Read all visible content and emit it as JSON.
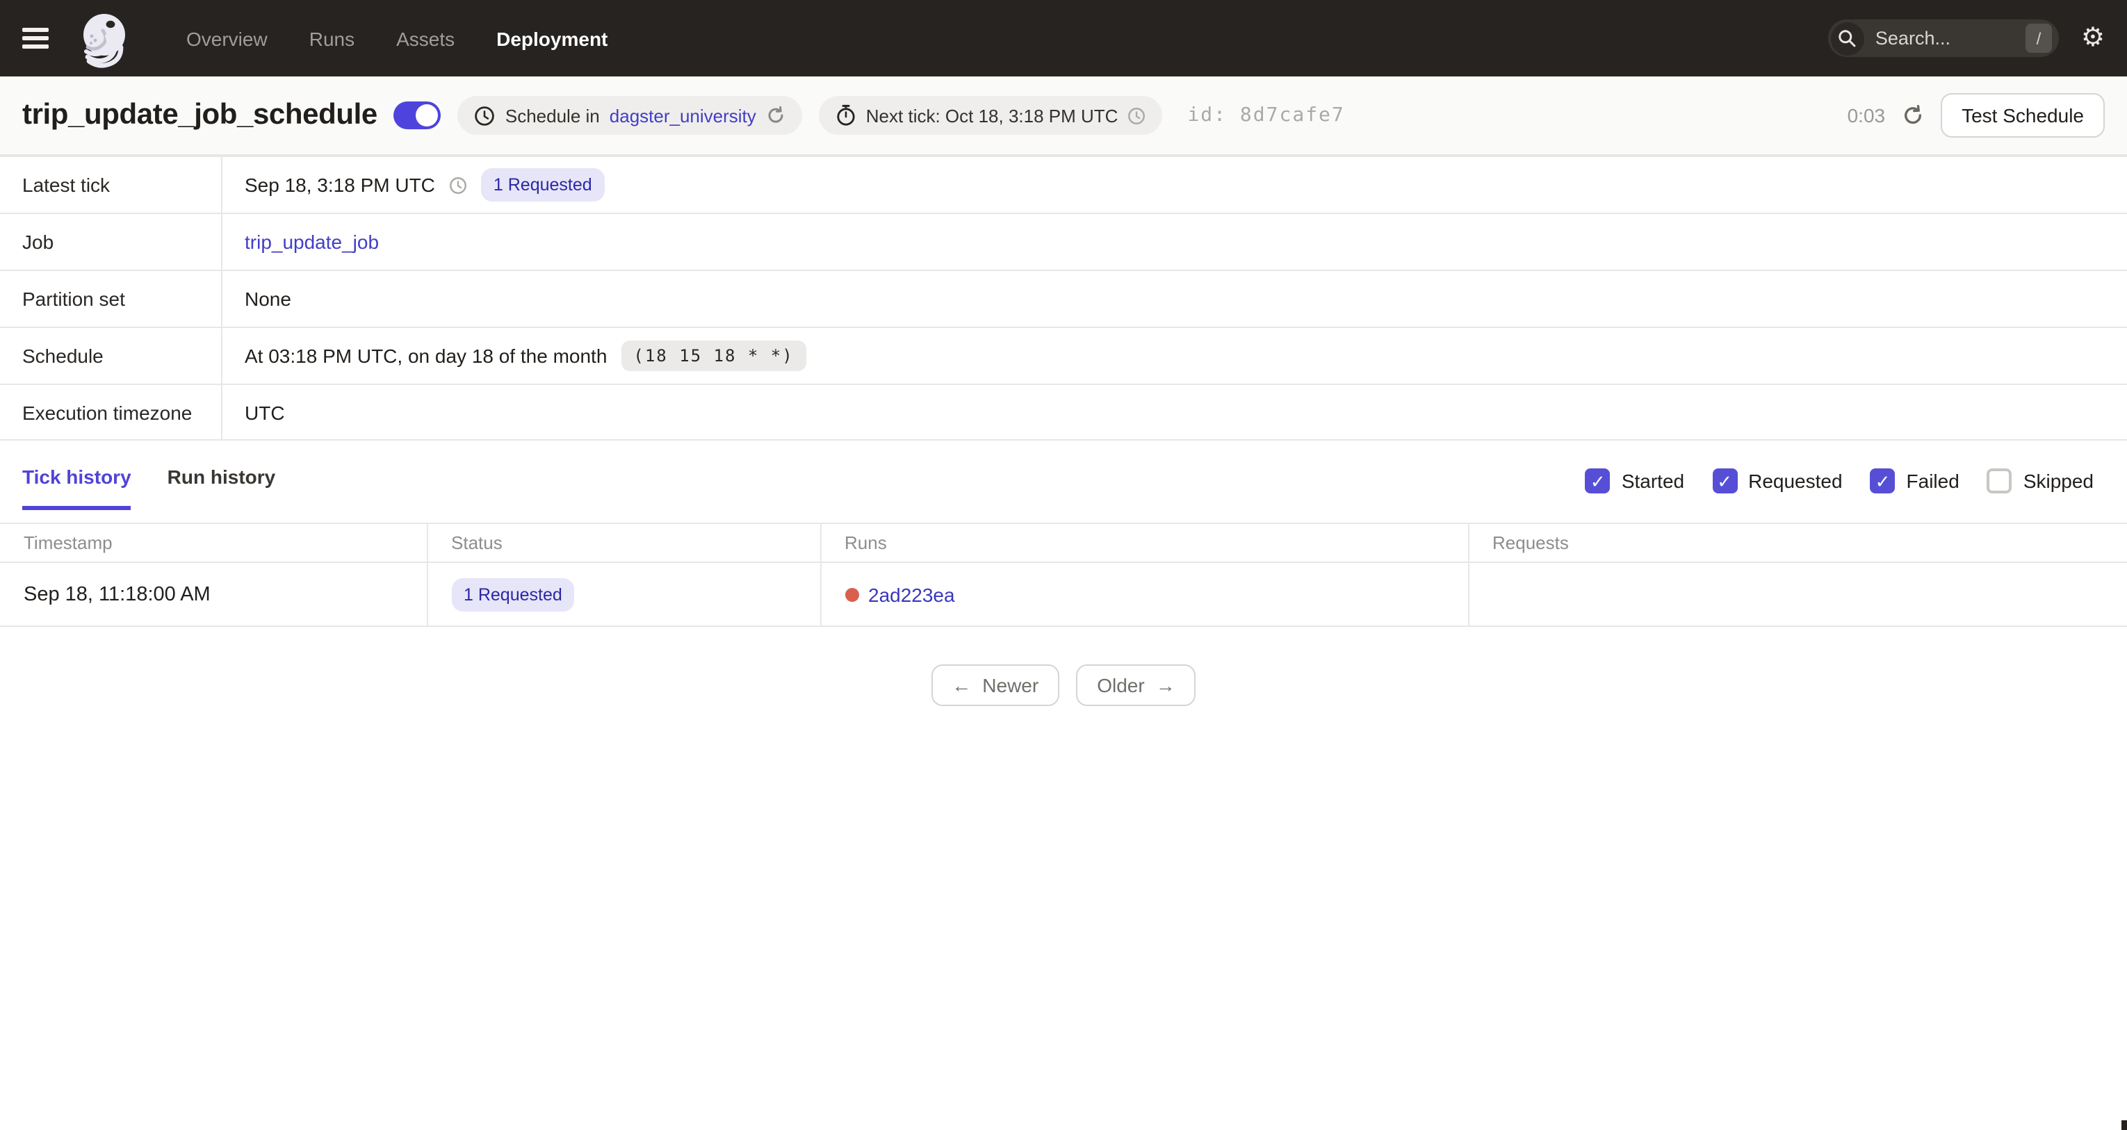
{
  "nav": {
    "links": [
      {
        "label": "Overview",
        "active": false
      },
      {
        "label": "Runs",
        "active": false
      },
      {
        "label": "Assets",
        "active": false
      },
      {
        "label": "Deployment",
        "active": true
      }
    ],
    "search": {
      "placeholder": "Search...",
      "shortcut": "/"
    }
  },
  "header": {
    "title": "trip_update_job_schedule",
    "toggle_on": true,
    "schedule_pill": {
      "prefix": "Schedule in",
      "repo_link": "dagster_university"
    },
    "next_tick_pill": {
      "text": "Next tick: Oct 18, 3:18 PM UTC"
    },
    "id_label": "id:",
    "id_value": "8d7cafe7",
    "countdown": "0:03",
    "test_button_label": "Test Schedule"
  },
  "details": {
    "rows": [
      {
        "label": "Latest tick",
        "value": "Sep 18, 3:18 PM UTC",
        "badge": "1 Requested"
      },
      {
        "label": "Job",
        "link": "trip_update_job"
      },
      {
        "label": "Partition set",
        "value": "None"
      },
      {
        "label": "Schedule",
        "value": "At 03:18 PM UTC, on day 18 of the month",
        "cron": "(18 15 18 * *)"
      },
      {
        "label": "Execution timezone",
        "value": "UTC"
      }
    ]
  },
  "tabs": [
    {
      "label": "Tick history",
      "active": true
    },
    {
      "label": "Run history",
      "active": false
    }
  ],
  "filters": [
    {
      "label": "Started",
      "checked": true
    },
    {
      "label": "Requested",
      "checked": true
    },
    {
      "label": "Failed",
      "checked": true
    },
    {
      "label": "Skipped",
      "checked": false
    }
  ],
  "table": {
    "columns": [
      "Timestamp",
      "Status",
      "Runs",
      "Requests"
    ],
    "rows": [
      {
        "timestamp": "Sep 18, 11:18:00 AM",
        "status_badge": "1 Requested",
        "run_id": "2ad223ea",
        "requests": ""
      }
    ]
  },
  "pagination": {
    "newer_label": "Newer",
    "older_label": "Older",
    "left_arrow": "←",
    "right_arrow": "→"
  },
  "colors": {
    "accent": "#4f43dd",
    "link": "#423ec6",
    "badge_bg": "#e7e5f8",
    "badge_text": "#2b28a5",
    "run_status_dot": "#d95f4f",
    "nav_bg": "#262321",
    "titlebar_bg": "#fafaf9"
  }
}
